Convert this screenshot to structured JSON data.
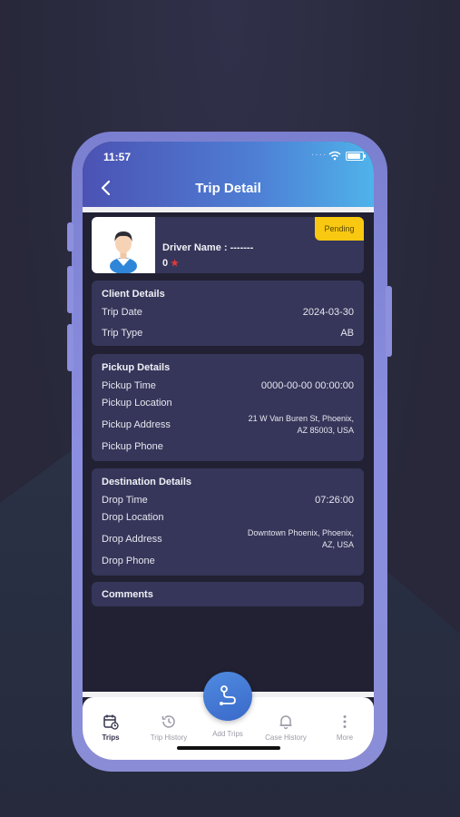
{
  "status_bar": {
    "time": "11:57",
    "dots": "····"
  },
  "header": {
    "title": "Trip Detail"
  },
  "driver": {
    "name_label": "Driver Name : -------",
    "rating": "0",
    "status_badge": "Pending"
  },
  "client_details": {
    "title": "Client Details",
    "rows": [
      {
        "label": "Trip Date",
        "value": "2024-03-30"
      },
      {
        "label": "Trip Type",
        "value": "AB"
      }
    ]
  },
  "pickup_details": {
    "title": "Pickup Details",
    "time_label": "Pickup Time",
    "time_value": "0000-00-00 00:00:00",
    "location_label": "Pickup Location",
    "address_label": "Pickup Address",
    "address_line1": "21 W Van Buren St, Phoenix,",
    "address_line2": "AZ 85003, USA",
    "phone_label": "Pickup Phone"
  },
  "destination_details": {
    "title": "Destination Details",
    "time_label": "Drop Time",
    "time_value": "07:26:00",
    "location_label": "Drop Location",
    "address_label": "Drop Address",
    "address_line1": "Downtown Phoenix, Phoenix,",
    "address_line2": "AZ, USA",
    "phone_label": "Drop Phone"
  },
  "comments": {
    "title": "Comments"
  },
  "tabbar": {
    "tabs": [
      {
        "label": "Trips",
        "icon": "calendar-clock-icon",
        "active": true
      },
      {
        "label": "Trip History",
        "icon": "history-icon"
      },
      {
        "label": "Add Trips",
        "icon": "route-icon"
      },
      {
        "label": "Case History",
        "icon": "bell-icon"
      },
      {
        "label": "More",
        "icon": "more-vertical-icon"
      }
    ]
  },
  "colors": {
    "header_start": "#4c52b3",
    "header_end": "#4fb3ea",
    "card_bg": "#36365a",
    "pending_badge": "#f9c810",
    "star": "#e23a3a"
  }
}
